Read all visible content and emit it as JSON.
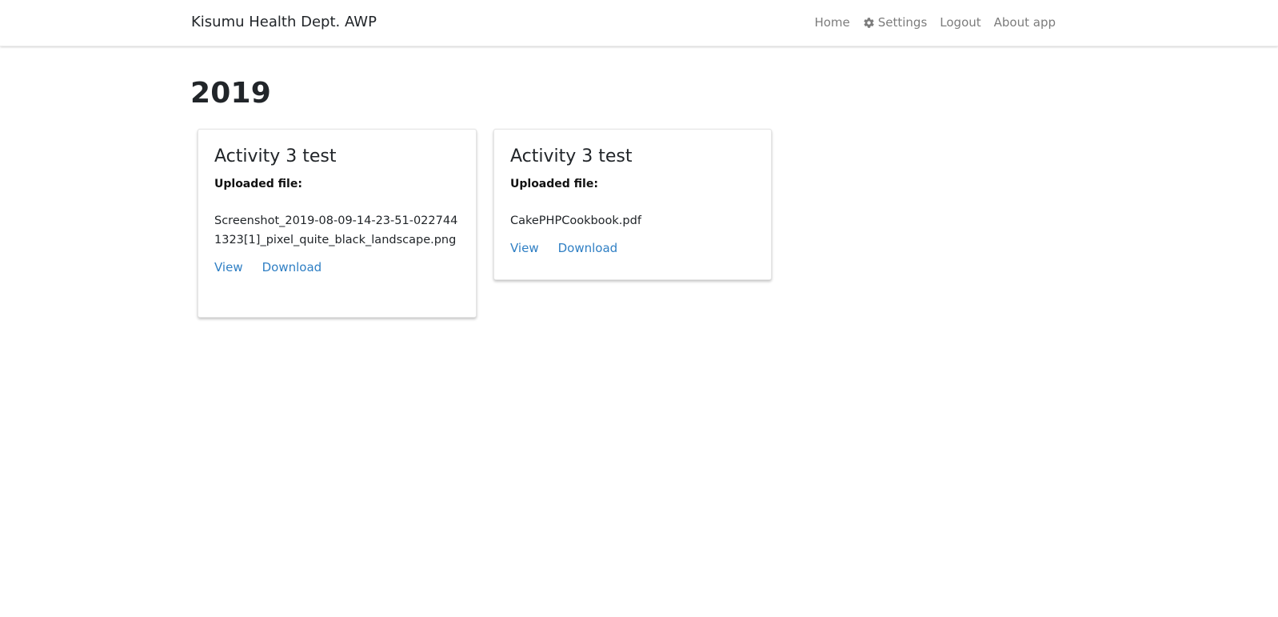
{
  "navbar": {
    "brand": "Kisumu Health Dept. AWP",
    "links": [
      {
        "label": "Home"
      },
      {
        "label": "Settings",
        "icon": "gear-icon"
      },
      {
        "label": "Logout"
      },
      {
        "label": "About app"
      }
    ]
  },
  "main": {
    "year_heading": "2019",
    "cards": [
      {
        "title": "Activity 3 test",
        "uploaded_label": "Uploaded file:",
        "file_name": "Screenshot_2019-08-09-14-23-51-0227441323[1]_pixel_quite_black_landscape.png",
        "view_label": "View",
        "download_label": "Download"
      },
      {
        "title": "Activity 3 test",
        "uploaded_label": "Uploaded file:",
        "file_name": "CakePHPCookbook.pdf",
        "view_label": "View",
        "download_label": "Download"
      }
    ]
  },
  "colors": {
    "link": "#2f7fc4",
    "nav_link": "#7c7c7c",
    "text": "#212529"
  }
}
